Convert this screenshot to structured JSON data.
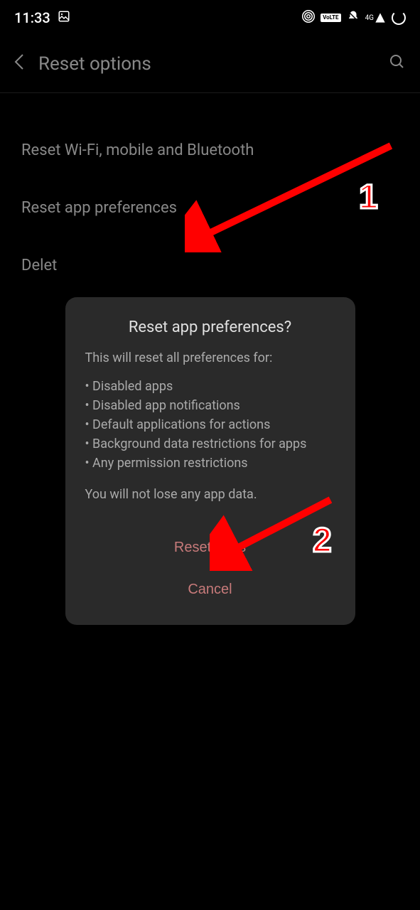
{
  "statusbar": {
    "time": "11:33",
    "network": "4G",
    "volte": "VoLTE"
  },
  "header": {
    "title": "Reset options"
  },
  "options": {
    "item1": "Reset Wi-Fi, mobile and Bluetooth",
    "item2": "Reset app preferences",
    "item3": "Delet"
  },
  "dialog": {
    "title": "Reset app preferences?",
    "subtitle": "This will reset all preferences for:",
    "list": {
      "item1": "• Disabled apps",
      "item2": "• Disabled app notifications",
      "item3": "• Default applications for actions",
      "item4": "• Background data restrictions for apps",
      "item5": "• Any permission restrictions"
    },
    "note": "You will not lose any app data.",
    "primary_button": "Reset apps",
    "secondary_button": "Cancel"
  },
  "annotations": {
    "number1": "1",
    "number2": "2"
  }
}
